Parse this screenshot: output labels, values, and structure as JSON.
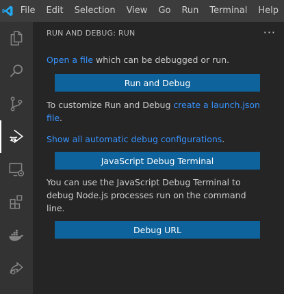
{
  "menubar": {
    "items": [
      "File",
      "Edit",
      "Selection",
      "View",
      "Go",
      "Run",
      "Terminal",
      "Help"
    ]
  },
  "activitybar": {
    "items": [
      "explorer-icon",
      "search-icon",
      "source-control-icon",
      "run-debug-icon",
      "remote-explorer-icon",
      "extensions-icon",
      "docker-icon",
      "live-share-icon"
    ],
    "active": "run-debug-icon"
  },
  "sidebar": {
    "title": "RUN AND DEBUG: RUN",
    "more_icon": "more-actions-icon",
    "open_file_link": "Open a file",
    "open_file_rest": " which can be debugged or run.",
    "run_debug_button": "Run and Debug",
    "customize_text": "To customize Run and Debug ",
    "create_launch_link": "create a launch.json file",
    "customize_end": ".",
    "show_all_link": "Show all automatic debug configurations",
    "show_all_end": ".",
    "js_terminal_button": "JavaScript Debug Terminal",
    "js_terminal_desc": "You can use the JavaScript Debug Terminal to debug Node.js processes run on the command line.",
    "debug_url_button": "Debug URL"
  },
  "colors": {
    "link": "#3794ff",
    "button": "#0e639c",
    "activitybar": "#333333",
    "sidebar": "#252526",
    "titlebar": "#3c3c3c"
  }
}
